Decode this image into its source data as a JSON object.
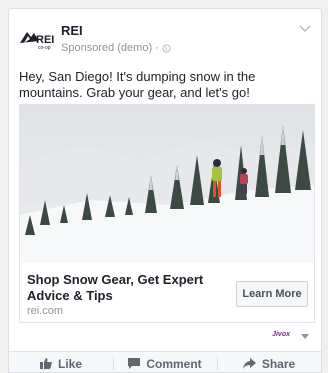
{
  "post": {
    "page_name": "REI",
    "sponsored_label": "Sponsored (demo) · ",
    "logo_text": "REI",
    "logo_subtext": "co-op",
    "message": "Hey, San Diego! It's dumping snow in the mountains. Grab your gear, and let's go!",
    "link_title": "Shop Snow Gear, Get Expert Advice & Tips",
    "link_domain": "rei.com",
    "cta_label": "Learn More",
    "brand_mark": "Jivox"
  },
  "actions": [
    {
      "label": "Like",
      "icon": "thumbs-up-icon"
    },
    {
      "label": "Comment",
      "icon": "comment-icon"
    },
    {
      "label": "Share",
      "icon": "share-icon"
    }
  ],
  "colors": {
    "text": "#1d2129",
    "secondary_text": "#90949c",
    "action_text": "#606770",
    "border": "#dcdee3",
    "action_bar_bg": "#f6f7f9"
  }
}
